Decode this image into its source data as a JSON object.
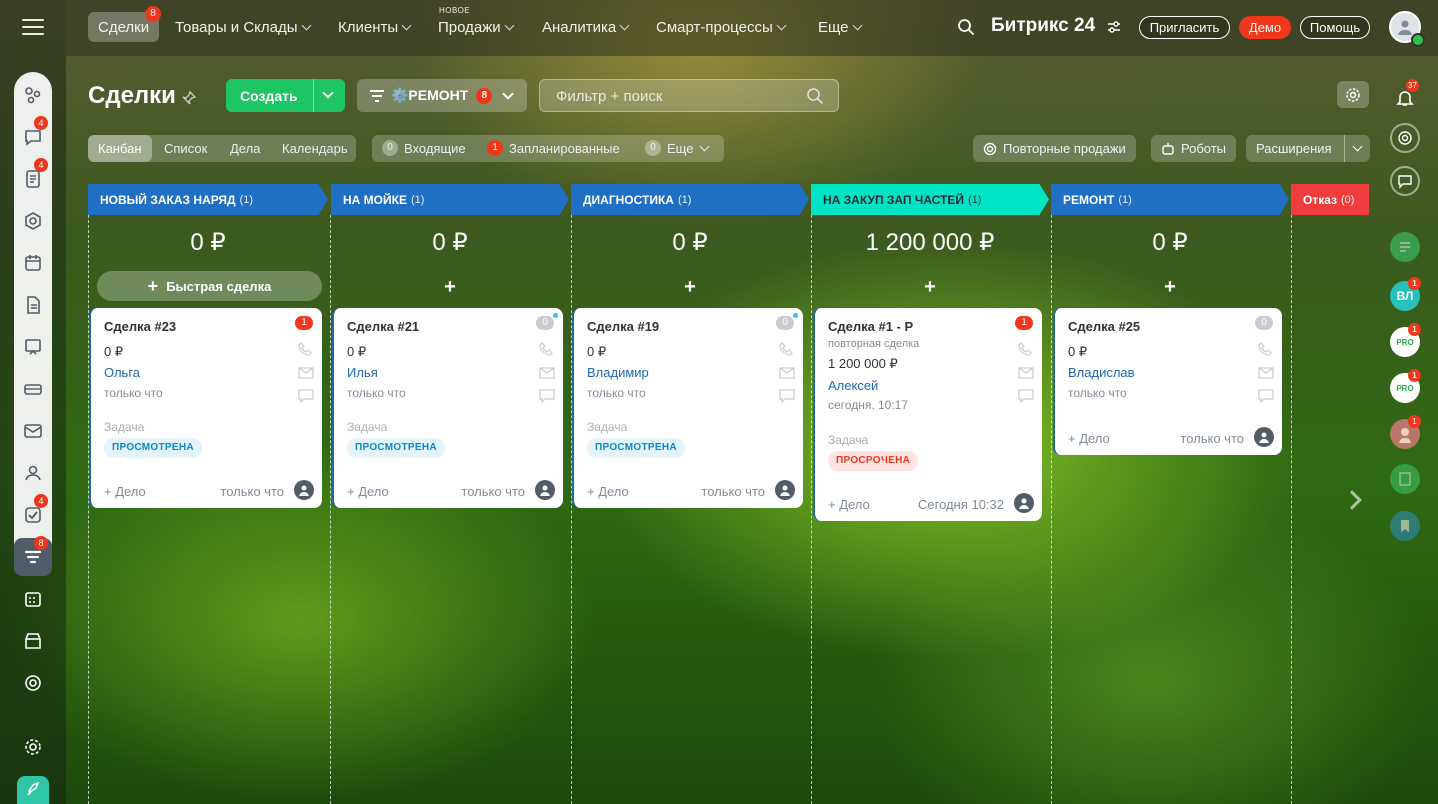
{
  "topbar": {
    "nav": [
      {
        "label": "Сделки",
        "badge": "8"
      },
      {
        "label": "Товары и Склады"
      },
      {
        "label": "Клиенты"
      },
      {
        "label": "Продажи",
        "tag": "НОВОЕ"
      },
      {
        "label": "Аналитика"
      },
      {
        "label": "Смарт-процессы"
      },
      {
        "label": "Еще"
      }
    ],
    "brand": "Битрикс 24",
    "invite": "Пригласить",
    "demo": "Демо",
    "help": "Помощь"
  },
  "left_rail": {
    "badges": {
      "chat": "4",
      "feed": "4",
      "tasks": "4",
      "crm": "8"
    }
  },
  "page": {
    "title": "Сделки",
    "create": "Создать",
    "funnel": "⚙️РЕМОНТ",
    "funnel_badge": "8",
    "search_placeholder": "Фильтр + поиск"
  },
  "views": [
    "Канбан",
    "Список",
    "Дела",
    "Календарь"
  ],
  "counters": [
    {
      "count": "0",
      "label": "Входящие"
    },
    {
      "count": "1",
      "label": "Запланированные"
    },
    {
      "count": "0",
      "label": "Еще"
    }
  ],
  "right_buttons": {
    "repeat": "Повторные продажи",
    "robots": "Роботы",
    "ext": "Расширения"
  },
  "quick_deal": "Быстрая сделка",
  "columns": [
    {
      "name": "НОВЫЙ ЗАКАЗ НАРЯД",
      "count": "(1)",
      "sum": "0 ₽",
      "color": "#1f6fc5"
    },
    {
      "name": "НА МОЙКЕ",
      "count": "(1)",
      "sum": "0 ₽",
      "color": "#1f6fc5"
    },
    {
      "name": "ДИАГНОСТИКА",
      "count": "(1)",
      "sum": "0 ₽",
      "color": "#1f6fc5"
    },
    {
      "name": "НА ЗАКУП ЗАП ЧАСТЕЙ",
      "count": "(1)",
      "sum": "1 200 000 ₽",
      "color": "#00e4c6"
    },
    {
      "name": "РЕМОНТ",
      "count": "(1)",
      "sum": "0 ₽",
      "color": "#1f6fc5"
    },
    {
      "name": "Отказ",
      "count": "(0)",
      "color": "#f03c3c"
    }
  ],
  "cards": [
    {
      "title": "Сделка #23",
      "counter": "1",
      "sum": "0 ₽",
      "client": "Ольга",
      "time": "только что",
      "task": "Задача",
      "status": "ПРОСМОТРЕНА",
      "add": "+ Дело",
      "when": "только что"
    },
    {
      "title": "Сделка #21",
      "counter": "0",
      "sum": "0 ₽",
      "client": "Илья",
      "time": "только что",
      "task": "Задача",
      "status": "ПРОСМОТРЕНА",
      "add": "+ Дело",
      "when": "только что"
    },
    {
      "title": "Сделка #19",
      "counter": "0",
      "sum": "0 ₽",
      "client": "Владимир",
      "time": "только что",
      "task": "Задача",
      "status": "ПРОСМОТРЕНА",
      "add": "+ Дело",
      "when": "только что"
    },
    {
      "title": "Сделка #1 - Р",
      "subtitle": "повторная сделка",
      "counter": "1",
      "sum": "1 200 000 ₽",
      "client": "Алексей",
      "time": "сегодня, 10:17",
      "task": "Задача",
      "status": "ПРОСРОЧЕНА",
      "add": "+ Дело",
      "when": "Сегодня 10:32"
    },
    {
      "title": "Сделка #25",
      "counter": "0",
      "sum": "0 ₽",
      "client": "Владислав",
      "time": "только что",
      "add": "+ Дело",
      "when": "только что"
    }
  ],
  "right_sidebar": {
    "notif_badge": "37",
    "user_initials": "ВЛ",
    "badges": [
      "1",
      "1",
      "1",
      "1"
    ]
  }
}
